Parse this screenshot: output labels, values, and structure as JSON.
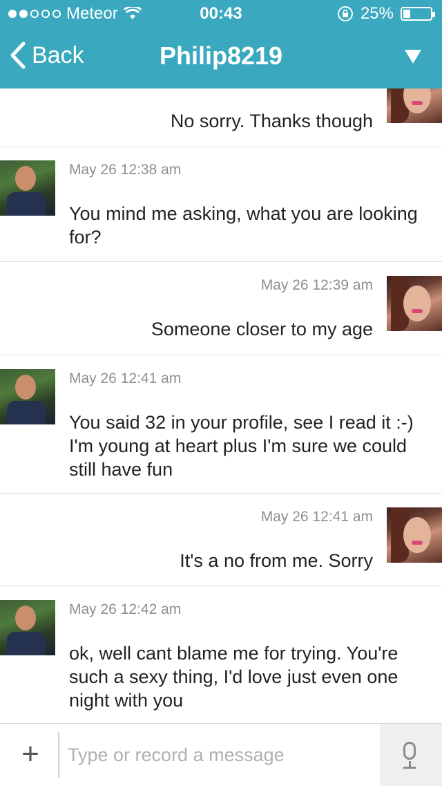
{
  "status": {
    "carrier": "Meteor",
    "time": "00:43",
    "battery": "25%",
    "battery_level": 0.25
  },
  "nav": {
    "back_label": "Back",
    "title": "Philip8219"
  },
  "messages": [
    {
      "sender": "self",
      "time": "",
      "text": "No sorry. Thanks though"
    },
    {
      "sender": "other",
      "time": "May 26 12:38 am",
      "text": "You mind me asking, what you are looking for?"
    },
    {
      "sender": "self",
      "time": "May 26 12:39 am",
      "text": "Someone closer to my age"
    },
    {
      "sender": "other",
      "time": "May 26 12:41 am",
      "text": "You said 32 in your profile, see I read it :-) I'm young at heart plus I'm sure we could still have fun"
    },
    {
      "sender": "self",
      "time": "May 26 12:41 am",
      "text": "It's a no from me. Sorry"
    },
    {
      "sender": "other",
      "time": "May 26 12:42 am",
      "text": "ok, well cant blame me for trying. You're such a sexy thing, I'd love just even one night with you"
    }
  ],
  "input": {
    "placeholder": "Type or record a message",
    "plus_label": "+"
  },
  "colors": {
    "header": "#3aa8be"
  },
  "icons": {
    "back": "chevron-left-icon",
    "menu": "triangle-down-icon",
    "wifi": "wifi-icon",
    "lock": "rotation-lock-icon",
    "mic": "microphone-icon",
    "add": "plus-icon"
  }
}
